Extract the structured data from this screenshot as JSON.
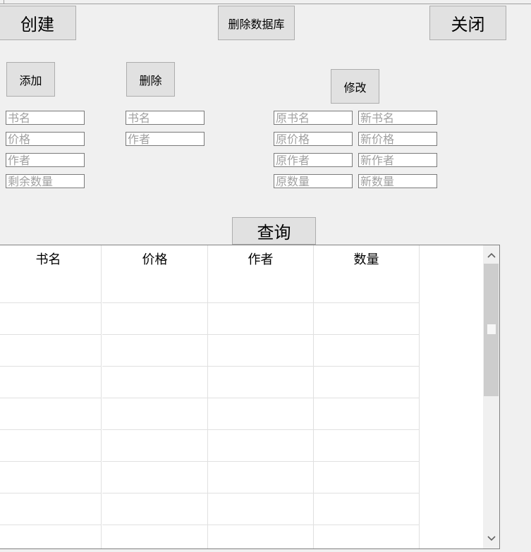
{
  "buttons": {
    "create": "创建",
    "delete_db": "删除数据库",
    "close": "关闭",
    "add": "添加",
    "delete": "删除",
    "modify": "修改",
    "query": "查询"
  },
  "add_form": {
    "name_placeholder": "书名",
    "price_placeholder": "价格",
    "author_placeholder": "作者",
    "qty_placeholder": "剩余数量"
  },
  "delete_form": {
    "name_placeholder": "书名",
    "author_placeholder": "作者"
  },
  "modify_form": {
    "old_name_placeholder": "原书名",
    "new_name_placeholder": "新书名",
    "old_price_placeholder": "原价格",
    "new_price_placeholder": "新价格",
    "old_author_placeholder": "原作者",
    "new_author_placeholder": "新作者",
    "old_qty_placeholder": "原数量",
    "new_qty_placeholder": "新数量"
  },
  "table": {
    "columns": [
      "书名",
      "价格",
      "作者",
      "数量"
    ],
    "rows": [
      [],
      [],
      [],
      [],
      [],
      [],
      [],
      [],
      []
    ]
  },
  "icons": {
    "scroll_up": "chevron-up-icon",
    "scroll_down": "chevron-down-icon"
  }
}
